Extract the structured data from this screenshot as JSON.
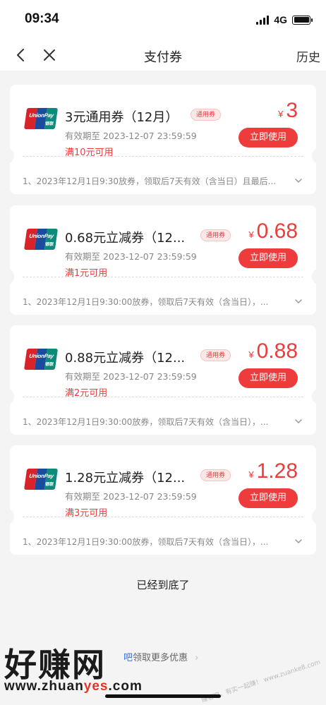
{
  "status_bar": {
    "time": "09:34",
    "network": "4G"
  },
  "nav": {
    "title": "支付券",
    "history_label": "历史"
  },
  "coupons": [
    {
      "logo_text": "UnionPay",
      "logo_sub": "银联",
      "title": "3元通用券（12月）",
      "tag": "通用券",
      "expire": "有效期至 2023-12-07 23:59:59",
      "condition": "满10元可用",
      "currency": "¥",
      "amount": "3",
      "button": "立即使用",
      "desc": "1、2023年12月1日9:30放券，领取后7天有效（含当日）且最后..."
    },
    {
      "logo_text": "UnionPay",
      "logo_sub": "银联",
      "title": "0.68元立减券（12...",
      "tag": "通用券",
      "expire": "有效期至 2023-12-07 23:59:59",
      "condition": "满1元可用",
      "currency": "¥",
      "amount": "0.68",
      "button": "立即使用",
      "desc": "1、2023年12月1日9:30:00放券，领取后7天有效（含当日），..."
    },
    {
      "logo_text": "UnionPay",
      "logo_sub": "银联",
      "title": "0.88元立减券（12...",
      "tag": "通用券",
      "expire": "有效期至 2023-12-07 23:59:59",
      "condition": "满2元可用",
      "currency": "¥",
      "amount": "0.88",
      "button": "立即使用",
      "desc": "1、2023年12月1日9:30:00放券，领取后7天有效（含当日），..."
    },
    {
      "logo_text": "UnionPay",
      "logo_sub": "银联",
      "title": "1.28元立减券（12...",
      "tag": "通用券",
      "expire": "有效期至 2023-12-07 23:59:59",
      "condition": "满3元可用",
      "currency": "¥",
      "amount": "1.28",
      "button": "立即使用",
      "desc": "1、2023年12月1日9:30:00放券，领取后7天有效（含当日），..."
    }
  ],
  "footer": {
    "end_tip": "已经到底了",
    "promo_link": "吧",
    "promo_text": "领取更多优惠",
    "promo_arrow": "›"
  },
  "watermark": {
    "title": "好赚网",
    "url_prefix": "www.zhuan",
    "url_highlight": "yes",
    "url_suffix": ".com",
    "corner_text": "赚客吧，有实一起赚！ www.zuanke8.com"
  },
  "colors": {
    "accent": "#ee3b3b",
    "background": "#f4f4f5"
  }
}
